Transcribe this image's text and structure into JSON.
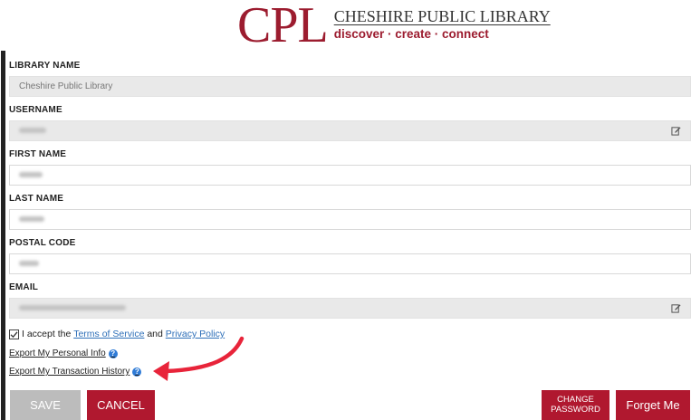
{
  "logo": {
    "mark": "CPL",
    "name": "CHESHIRE PUBLIC LIBRARY",
    "tagline": "discover · create · connect"
  },
  "fields": {
    "library_name": {
      "label": "LIBRARY NAME",
      "value": "Cheshire Public Library"
    },
    "username": {
      "label": "USERNAME"
    },
    "first_name": {
      "label": "FIRST NAME"
    },
    "last_name": {
      "label": "LAST NAME"
    },
    "postal_code": {
      "label": "POSTAL CODE"
    },
    "email": {
      "label": "EMAIL"
    }
  },
  "terms": {
    "checked": true,
    "prefix": "I accept the",
    "terms_link": "Terms of Service",
    "middle": "and",
    "privacy_link": "Privacy Policy"
  },
  "links": {
    "export_personal": "Export My Personal Info",
    "export_transactions": "Export My Transaction History"
  },
  "buttons": {
    "save": "SAVE",
    "cancel": "CANCEL",
    "change_password": "CHANGE PASSWORD",
    "forget_me": "Forget Me"
  },
  "icons": {
    "edit": "edit-icon",
    "help": "help-icon",
    "check": "checkmark-icon",
    "arrow": "arrow-annotation"
  },
  "colors": {
    "brand": "#9c1c2f",
    "button_primary": "#b0182f",
    "button_disabled": "#bcbcbc",
    "link": "#2e6fb8",
    "help_icon": "#2f7bd6"
  }
}
